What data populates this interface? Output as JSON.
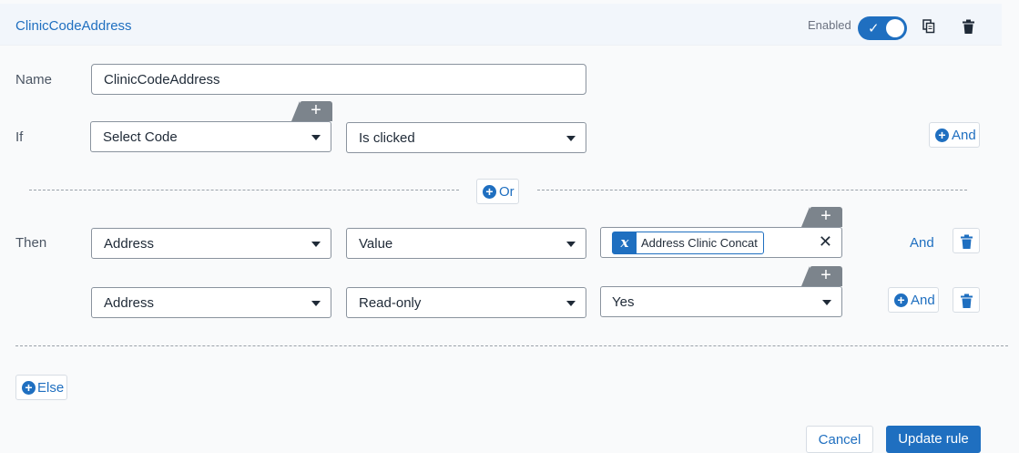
{
  "header": {
    "title": "ClinicCodeAddress",
    "enabled_label": "Enabled",
    "enabled": true
  },
  "name_row": {
    "label": "Name",
    "value": "ClinicCodeAddress"
  },
  "if_row": {
    "label": "If",
    "field": "Select Code",
    "condition": "Is clicked",
    "and_label": "And"
  },
  "or_label": "Or",
  "then_row": {
    "label": "Then",
    "actions": [
      {
        "target": "Address",
        "property": "Value",
        "value_chip": "Address Clinic Concat",
        "and_label": "And"
      },
      {
        "target": "Address",
        "property": "Read-only",
        "value": "Yes",
        "and_label": "And"
      }
    ]
  },
  "else_label": "Else",
  "footer": {
    "cancel": "Cancel",
    "submit": "Update rule"
  },
  "colors": {
    "accent": "#1f6fc0",
    "header_bg": "#f2f6fb",
    "plus_tab": "#7c848c"
  },
  "icons": {
    "toggle": "check-icon",
    "copy": "copy-icon",
    "delete": "trash-icon",
    "add": "plus-icon",
    "circle_add": "circle-plus-icon",
    "dropdown": "caret-down-icon",
    "formula": "function-icon",
    "clear": "close-icon"
  }
}
